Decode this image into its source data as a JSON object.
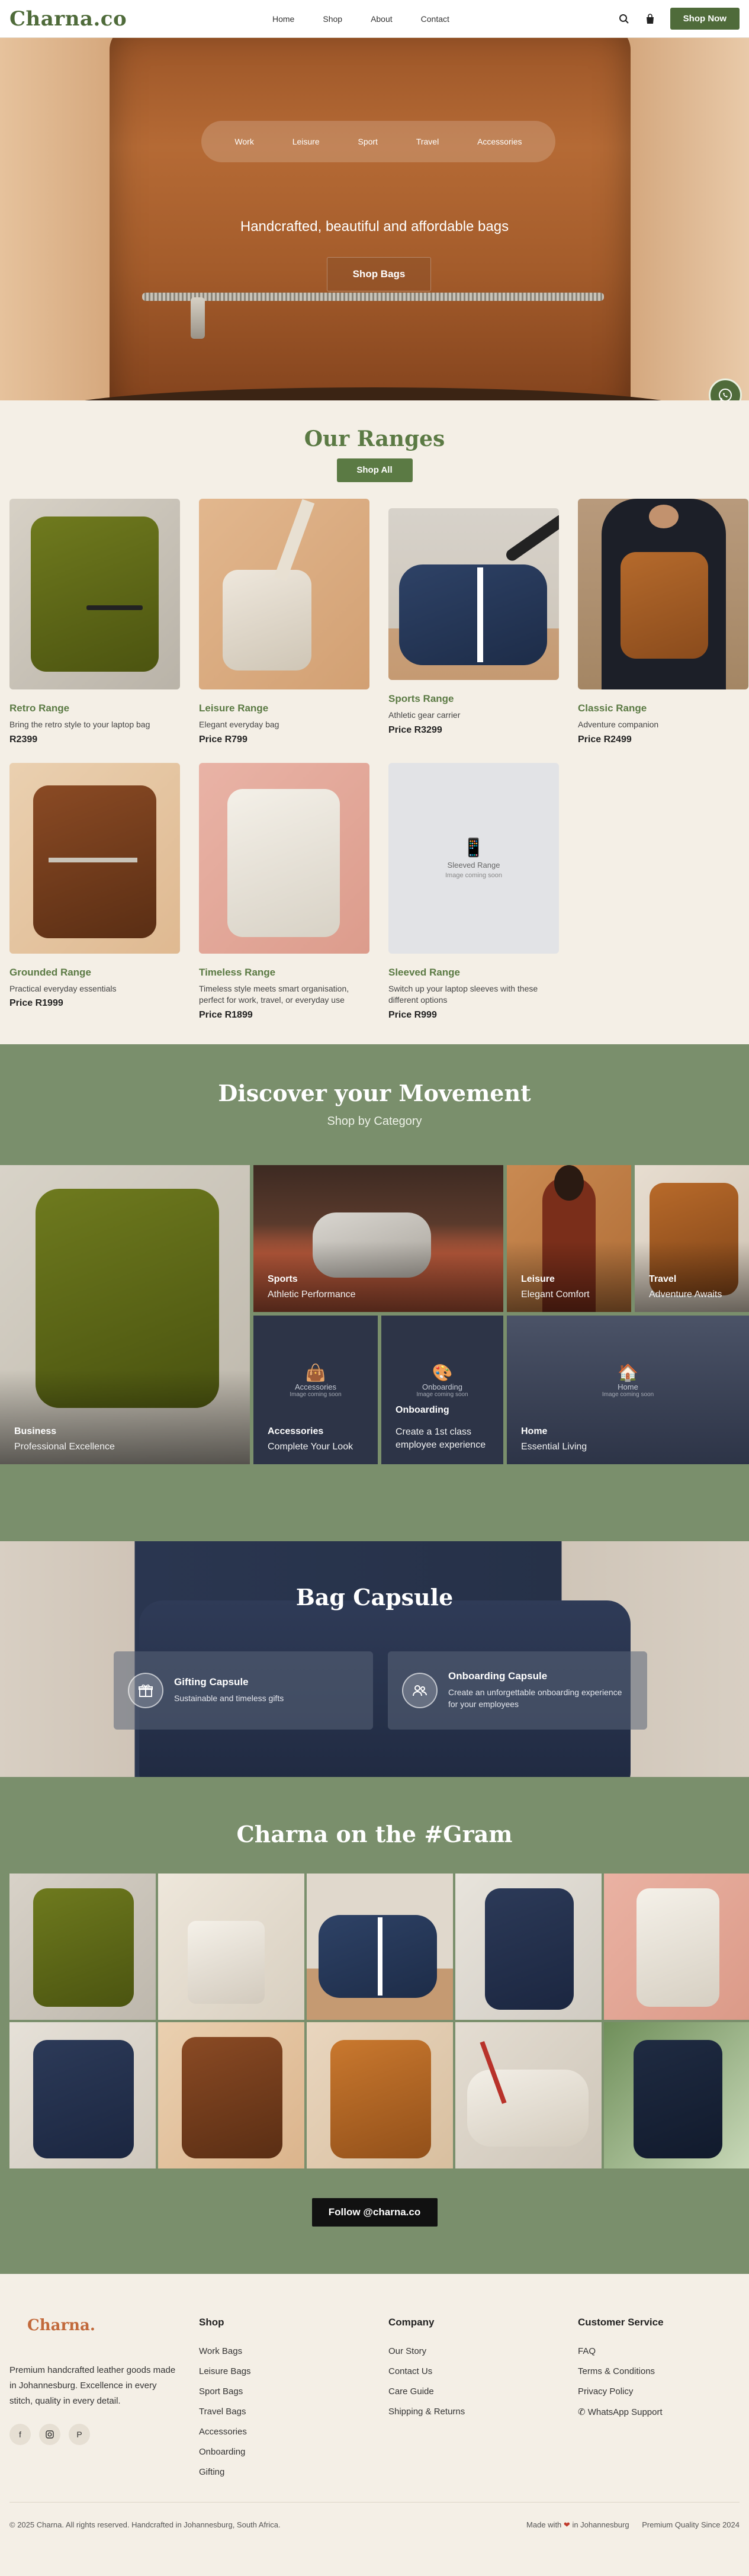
{
  "nav": {
    "logo": "Charna.co",
    "links": [
      "Home",
      "Shop",
      "About",
      "Contact"
    ],
    "search_icon": "search-icon",
    "cart_icon": "shopping-bag-icon",
    "cta": "Shop Now"
  },
  "hero": {
    "categories": [
      "Work",
      "Leisure",
      "Sport",
      "Travel",
      "Accessories"
    ],
    "tagline": "Handcrafted, beautiful and affordable bags",
    "button": "Shop Bags"
  },
  "ranges": {
    "title": "Our Ranges",
    "button": "Shop All",
    "products": [
      {
        "name": "Retro Range",
        "desc": "Bring the retro style to your laptop bag",
        "price": "R2399"
      },
      {
        "name": "Leisure Range",
        "desc": "Elegant everyday bag",
        "price": "Price R799"
      },
      {
        "name": "Sports Range",
        "desc": "Athletic gear carrier",
        "price": "Price R3299"
      },
      {
        "name": "Classic Range",
        "desc": "Adventure companion",
        "price": "Price R2499"
      },
      {
        "name": "Grounded Range",
        "desc": "Practical everyday essentials",
        "price": "Price R1999"
      },
      {
        "name": "Timeless Range",
        "desc": "Timeless style meets smart organisation, perfect for work, travel, or everyday use",
        "price": "Price R1899"
      },
      {
        "name": "Sleeved Range",
        "desc": "Switch up your laptop sleeves with these different options",
        "price": "Price R999"
      }
    ],
    "placeholder": {
      "title": "Sleeved Range",
      "note": "Image coming soon"
    }
  },
  "discover": {
    "title": "Discover your Movement",
    "subtitle": "Shop by Category",
    "tiles": {
      "business": {
        "label": "Business",
        "sub": "Professional Excellence"
      },
      "sports": {
        "label": "Sports",
        "sub": "Athletic Performance"
      },
      "leisure": {
        "label": "Leisure",
        "sub": "Elegant Comfort"
      },
      "travel": {
        "label": "Travel",
        "sub": "Adventure Awaits"
      },
      "accessories": {
        "label": "Accessories",
        "sub": "Complete Your Look",
        "ph": "Accessories",
        "ph_note": "Image coming soon"
      },
      "onboarding": {
        "label": "Onboarding",
        "sub": "Create a 1st class employee experience",
        "ph": "Onboarding",
        "ph_note": "Image coming soon"
      },
      "home": {
        "label": "Home",
        "sub": "Essential Living",
        "ph": "Home",
        "ph_note": "Image coming soon"
      }
    }
  },
  "capsule": {
    "title": "Bag Capsule",
    "cards": [
      {
        "title": "Gifting Capsule",
        "desc": "Sustainable and timeless gifts",
        "icon": "gift-icon"
      },
      {
        "title": "Onboarding Capsule",
        "desc": "Create an unforgettable onboarding experience for your employees",
        "icon": "users-icon"
      }
    ]
  },
  "gram": {
    "title": "Charna on the #Gram",
    "button": "Follow @charna.co"
  },
  "footer": {
    "logo": "Charna.",
    "about": "Premium handcrafted leather goods made in Johannesburg. Excellence in every stitch, quality in every detail.",
    "socials": [
      "facebook-icon",
      "instagram-icon",
      "pinterest-icon"
    ],
    "shop": {
      "heading": "Shop",
      "items": [
        "Work Bags",
        "Leisure Bags",
        "Sport Bags",
        "Travel Bags",
        "Accessories",
        "Onboarding",
        "Gifting"
      ]
    },
    "company": {
      "heading": "Company",
      "items": [
        "Our Story",
        "Contact Us",
        "Care Guide",
        "Shipping & Returns"
      ]
    },
    "service": {
      "heading": "Customer Service",
      "items": [
        "FAQ",
        "Terms & Conditions",
        "Privacy Policy",
        "WhatsApp Support"
      ]
    },
    "copyright": "© 2025 Charna. All rights reserved. Handcrafted in Johannesburg, South Africa.",
    "made_pre": "Made with",
    "made_post": "in Johannesburg",
    "quality": "Premium Quality Since 2024"
  },
  "colors": {
    "brand_green": "#4f6b3a",
    "section_green": "#7a8f6c",
    "cream": "#f4efe6",
    "logo_orange": "#c26a3c"
  }
}
